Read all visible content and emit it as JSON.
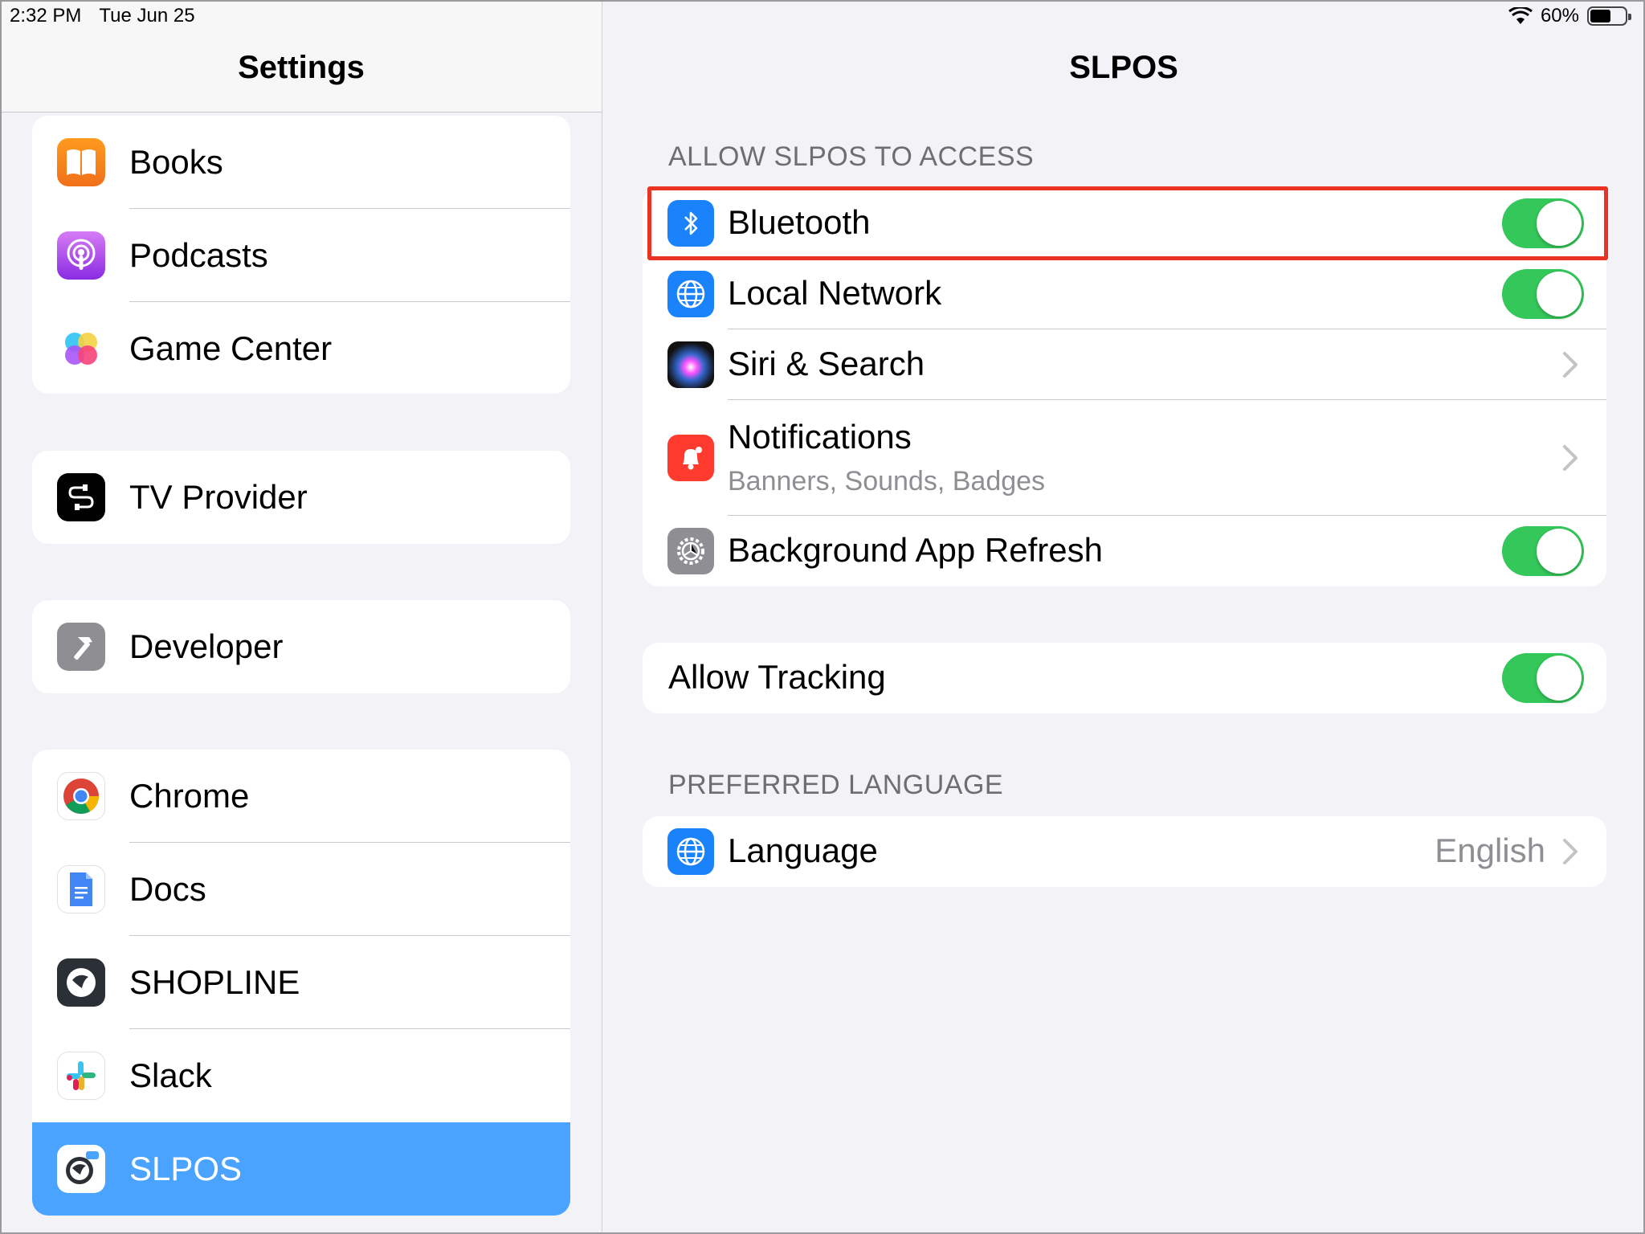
{
  "status_bar": {
    "time": "2:32 PM",
    "date": "Tue Jun 25",
    "battery_percent": "60%",
    "battery_level": 0.6
  },
  "sidebar": {
    "title": "Settings",
    "groups": [
      {
        "items": [
          {
            "label": "Books",
            "icon": "books-icon"
          },
          {
            "label": "Podcasts",
            "icon": "podcasts-icon"
          },
          {
            "label": "Game Center",
            "icon": "game-center-icon"
          }
        ]
      },
      {
        "items": [
          {
            "label": "TV Provider",
            "icon": "tv-provider-icon"
          }
        ]
      },
      {
        "items": [
          {
            "label": "Developer",
            "icon": "developer-icon"
          }
        ]
      },
      {
        "items": [
          {
            "label": "Chrome",
            "icon": "chrome-icon"
          },
          {
            "label": "Docs",
            "icon": "docs-icon"
          },
          {
            "label": "SHOPLINE",
            "icon": "shopline-icon"
          },
          {
            "label": "Slack",
            "icon": "slack-icon"
          },
          {
            "label": "SLPOS",
            "icon": "slpos-icon",
            "selected": true
          }
        ]
      }
    ]
  },
  "main": {
    "title": "SLPOS",
    "access_header": "ALLOW SLPOS  TO ACCESS",
    "access_rows": [
      {
        "label": "Bluetooth",
        "icon": "bluetooth-icon",
        "control": "toggle",
        "on": true,
        "highlighted": true
      },
      {
        "label": "Local Network",
        "icon": "globe-icon",
        "control": "toggle",
        "on": true
      },
      {
        "label": "Siri & Search",
        "icon": "siri-icon",
        "control": "chevron"
      },
      {
        "label": "Notifications",
        "sublabel": "Banners, Sounds, Badges",
        "icon": "bell-icon",
        "control": "chevron"
      },
      {
        "label": "Background App Refresh",
        "icon": "gear-icon",
        "control": "toggle",
        "on": true
      }
    ],
    "tracking": {
      "label": "Allow Tracking",
      "on": true
    },
    "language_header": "PREFERRED LANGUAGE",
    "language": {
      "label": "Language",
      "value": "English",
      "icon": "globe-icon"
    }
  },
  "colors": {
    "toggle_on": "#34c759",
    "selected": "#4aa3ff",
    "highlight": "#ea3323",
    "blue_icon": "#1a82fb"
  }
}
